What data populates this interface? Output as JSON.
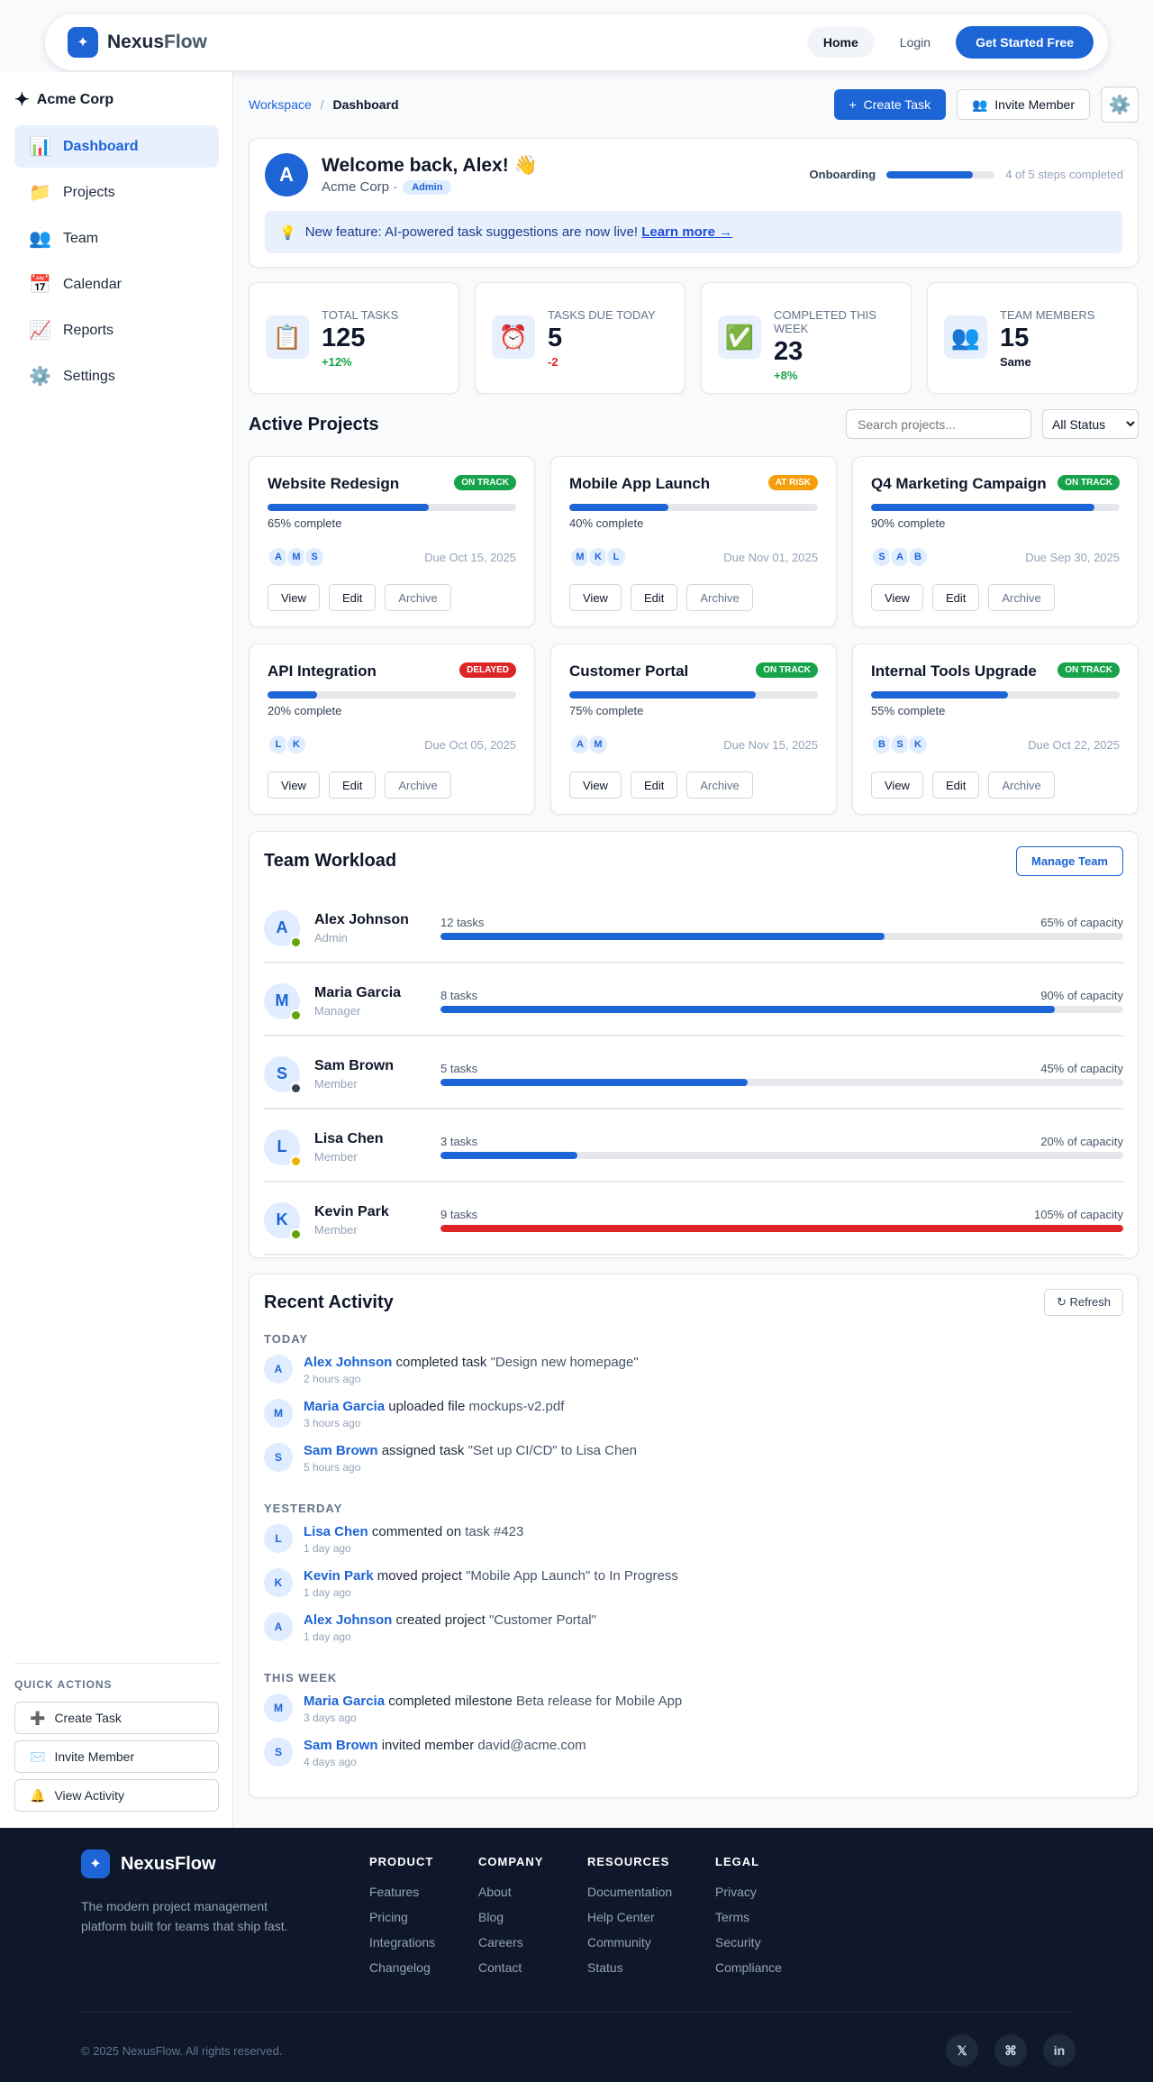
{
  "topnav": {
    "brand_name": "Nexus",
    "brand_name_suffix": "Flow",
    "logo_icon": "sparkle-icon",
    "home_label": "Home",
    "login_label": "Login",
    "cta_label": "Get Started Free"
  },
  "sidebar": {
    "org_name": "Acme Corp",
    "items": [
      {
        "label": "Dashboard",
        "icon": "📊",
        "active": true
      },
      {
        "label": "Projects",
        "icon": "📁"
      },
      {
        "label": "Team",
        "icon": "👥"
      },
      {
        "label": "Calendar",
        "icon": "📅"
      },
      {
        "label": "Reports",
        "icon": "📈"
      },
      {
        "label": "Settings",
        "icon": "⚙️"
      }
    ],
    "quick_actions_title": "QUICK ACTIONS",
    "quick_actions": [
      {
        "label": "Create Task",
        "icon": "➕"
      },
      {
        "label": "Invite Member",
        "icon": "✉️"
      },
      {
        "label": "View Activity",
        "icon": "🔔"
      }
    ]
  },
  "breadcrumb": {
    "root": "Workspace",
    "sep": "/",
    "current": "Dashboard"
  },
  "header_actions": {
    "create_task": "Create Task",
    "create_icon": "+",
    "invite_member": "Invite Member",
    "invite_icon": "👥",
    "settings_icon": "⚙️"
  },
  "welcome": {
    "avatar_initial": "A",
    "title": "Welcome back, Alex! 👋",
    "org": "Acme Corp ·",
    "role": "Admin",
    "onboarding_label": "Onboarding",
    "onboarding_progress": 0.8,
    "onboarding_text": "4 of 5 steps completed",
    "banner_icon": "💡",
    "banner_text": "New feature: AI-powered task suggestions are now live!",
    "banner_link": "Learn more →"
  },
  "stats": [
    {
      "icon": "📋",
      "label": "Total Tasks",
      "value": "125",
      "change": "+12%",
      "trend": "up"
    },
    {
      "icon": "⏰",
      "label": "Tasks Due Today",
      "value": "5",
      "change": "-2",
      "trend": "down"
    },
    {
      "icon": "✅",
      "label": "Completed This Week",
      "value": "23",
      "change": "+8%",
      "trend": "up"
    },
    {
      "icon": "👥",
      "label": "Team Members",
      "value": "15",
      "change": "Same",
      "trend": "same"
    }
  ],
  "projects_section": {
    "title": "Active Projects",
    "search_placeholder": "Search projects...",
    "filter_selected": "All Status",
    "btn_view": "View",
    "btn_edit": "Edit",
    "btn_archive": "Archive"
  },
  "status_colors": {
    "ON TRACK": "#16a34a",
    "AT RISK": "#f59e0b",
    "DELAYED": "#dc2626"
  },
  "projects": [
    {
      "name": "Website Redesign",
      "status": "ON TRACK",
      "progress": 65,
      "progress_text": "65% complete",
      "members": [
        "A",
        "M",
        "S"
      ],
      "due": "Due Oct 15, 2025"
    },
    {
      "name": "Mobile App Launch",
      "status": "AT RISK",
      "progress": 40,
      "progress_text": "40% complete",
      "members": [
        "M",
        "K",
        "L"
      ],
      "due": "Due Nov 01, 2025"
    },
    {
      "name": "Q4 Marketing Campaign",
      "status": "ON TRACK",
      "progress": 90,
      "progress_text": "90% complete",
      "members": [
        "S",
        "A",
        "B"
      ],
      "due": "Due Sep 30, 2025"
    },
    {
      "name": "API Integration",
      "status": "DELAYED",
      "progress": 20,
      "progress_text": "20% complete",
      "members": [
        "L",
        "K"
      ],
      "due": "Due Oct 05, 2025"
    },
    {
      "name": "Customer Portal",
      "status": "ON TRACK",
      "progress": 75,
      "progress_text": "75% complete",
      "members": [
        "A",
        "M"
      ],
      "due": "Due Nov 15, 2025"
    },
    {
      "name": "Internal Tools Upgrade",
      "status": "ON TRACK",
      "progress": 55,
      "progress_text": "55% complete",
      "members": [
        "B",
        "S",
        "K"
      ],
      "due": "Due Oct 22, 2025"
    }
  ],
  "workload": {
    "title": "Team Workload",
    "manage_label": "Manage Team",
    "members": [
      {
        "initial": "A",
        "name": "Alex Johnson",
        "role": "Admin",
        "tasks": "12 tasks",
        "capacity": 65,
        "capacity_text": "65% of capacity",
        "presence": "#65a30d",
        "bar": "#1d64d6"
      },
      {
        "initial": "M",
        "name": "Maria Garcia",
        "role": "Manager",
        "tasks": "8 tasks",
        "capacity": 90,
        "capacity_text": "90% of capacity",
        "presence": "#65a30d",
        "bar": "#1d64d6"
      },
      {
        "initial": "S",
        "name": "Sam Brown",
        "role": "Member",
        "tasks": "5 tasks",
        "capacity": 45,
        "capacity_text": "45% of capacity",
        "presence": "#374151",
        "bar": "#1d64d6"
      },
      {
        "initial": "L",
        "name": "Lisa Chen",
        "role": "Member",
        "tasks": "3 tasks",
        "capacity": 20,
        "capacity_text": "20% of capacity",
        "presence": "#eab308",
        "bar": "#1d64d6"
      },
      {
        "initial": "K",
        "name": "Kevin Park",
        "role": "Member",
        "tasks": "9 tasks",
        "capacity": 105,
        "capacity_text": "105% of capacity",
        "presence": "#65a30d",
        "bar": "#dc2626"
      }
    ]
  },
  "activity": {
    "title": "Recent Activity",
    "refresh_label": "↻ Refresh",
    "groups": [
      {
        "title": "TODAY",
        "items": [
          {
            "initial": "A",
            "user": "Alex Johnson",
            "action": "completed task",
            "object": "\"Design new homepage\"",
            "time": "2 hours ago"
          },
          {
            "initial": "M",
            "user": "Maria Garcia",
            "action": "uploaded file",
            "object": "mockups-v2.pdf",
            "time": "3 hours ago"
          },
          {
            "initial": "S",
            "user": "Sam Brown",
            "action": "assigned task",
            "object": "\"Set up CI/CD\" to Lisa Chen",
            "time": "5 hours ago"
          }
        ]
      },
      {
        "title": "YESTERDAY",
        "items": [
          {
            "initial": "L",
            "user": "Lisa Chen",
            "action": "commented on",
            "object": "task #423",
            "time": "1 day ago"
          },
          {
            "initial": "K",
            "user": "Kevin Park",
            "action": "moved project",
            "object": "\"Mobile App Launch\" to In Progress",
            "time": "1 day ago"
          },
          {
            "initial": "A",
            "user": "Alex Johnson",
            "action": "created project",
            "object": "\"Customer Portal\"",
            "time": "1 day ago"
          }
        ]
      },
      {
        "title": "THIS WEEK",
        "items": [
          {
            "initial": "M",
            "user": "Maria Garcia",
            "action": "completed milestone",
            "object": "Beta release for Mobile App",
            "time": "3 days ago"
          },
          {
            "initial": "S",
            "user": "Sam Brown",
            "action": "invited member",
            "object": "david@acme.com",
            "time": "4 days ago"
          }
        ]
      }
    ]
  },
  "footer": {
    "brand": "NexusFlow",
    "tagline": "The modern project management platform built for teams that ship fast.",
    "columns": [
      {
        "title": "PRODUCT",
        "links": [
          "Features",
          "Pricing",
          "Integrations",
          "Changelog"
        ]
      },
      {
        "title": "COMPANY",
        "links": [
          "About",
          "Blog",
          "Careers",
          "Contact"
        ]
      },
      {
        "title": "RESOURCES",
        "links": [
          "Documentation",
          "Help Center",
          "Community",
          "Status"
        ]
      },
      {
        "title": "LEGAL",
        "links": [
          "Privacy",
          "Terms",
          "Security",
          "Compliance"
        ]
      }
    ],
    "copyright": "© 2025 NexusFlow. All rights reserved.",
    "socials": [
      {
        "name": "x-icon",
        "glyph": "𝕏"
      },
      {
        "name": "github-icon",
        "glyph": "⌘"
      },
      {
        "name": "linkedin-icon",
        "glyph": "in"
      }
    ]
  }
}
